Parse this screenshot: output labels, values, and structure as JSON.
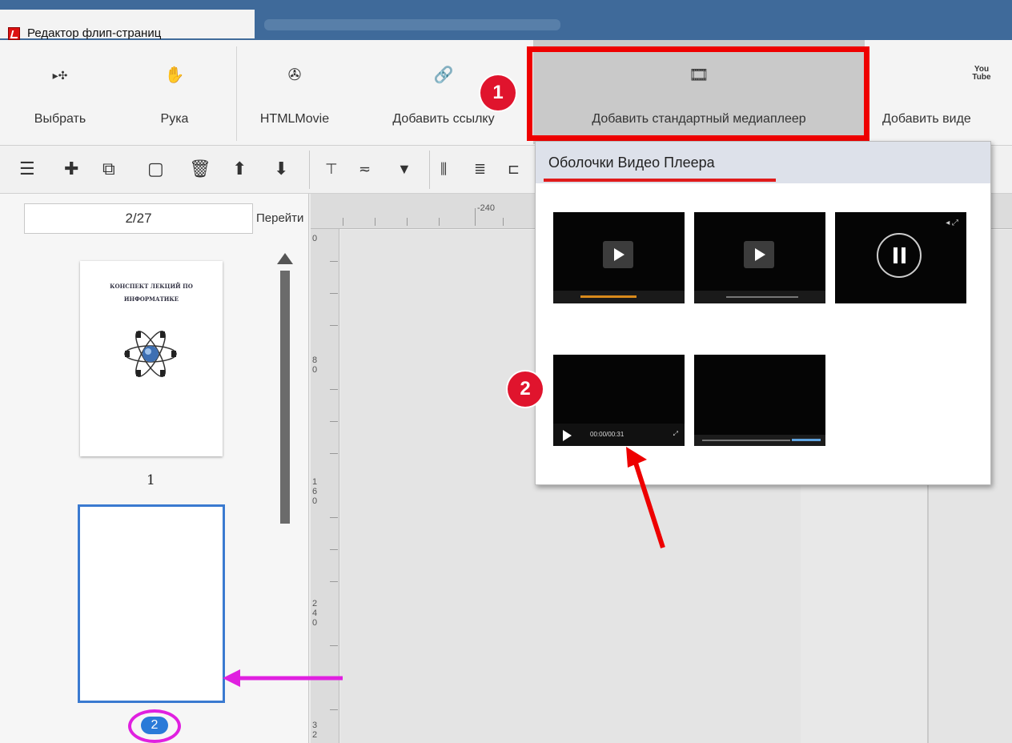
{
  "window": {
    "title": "Редактор флип-страниц"
  },
  "toolbar": {
    "select_label": "Выбрать",
    "hand_label": "Рука",
    "htmlmovie_label": "HTMLMovie",
    "add_link_label": "Добавить ссылку",
    "add_media_label": "Добавить стандартный  медиаплеер",
    "add_video_label": "Добавить виде",
    "youtube_icon_text": "You\nTube"
  },
  "annotations": {
    "step1": "1",
    "step2": "2"
  },
  "pages": {
    "current": "2/27",
    "go_label": "Перейти",
    "thumb1_title": "КОНСПЕКТ ЛЕКЦИЙ ПО ИНФОРМАТИКЕ",
    "thumb1_number": "1",
    "thumb2_number": "2"
  },
  "ruler": {
    "h_label": "-240",
    "v_labels": [
      "0",
      "80",
      "160",
      "240",
      "32"
    ]
  },
  "popup": {
    "header": "Оболочки Видео Плеера",
    "skins": [
      {
        "name": "skin-1"
      },
      {
        "name": "skin-2"
      },
      {
        "name": "skin-3"
      },
      {
        "name": "skin-4",
        "time": "00:00/00:31"
      },
      {
        "name": "skin-5"
      }
    ]
  },
  "colors": {
    "title_bar": "#3f6a9a",
    "highlight_red": "#e00000",
    "selected_page": "#3a7ad0",
    "magenta": "#e020e0"
  }
}
